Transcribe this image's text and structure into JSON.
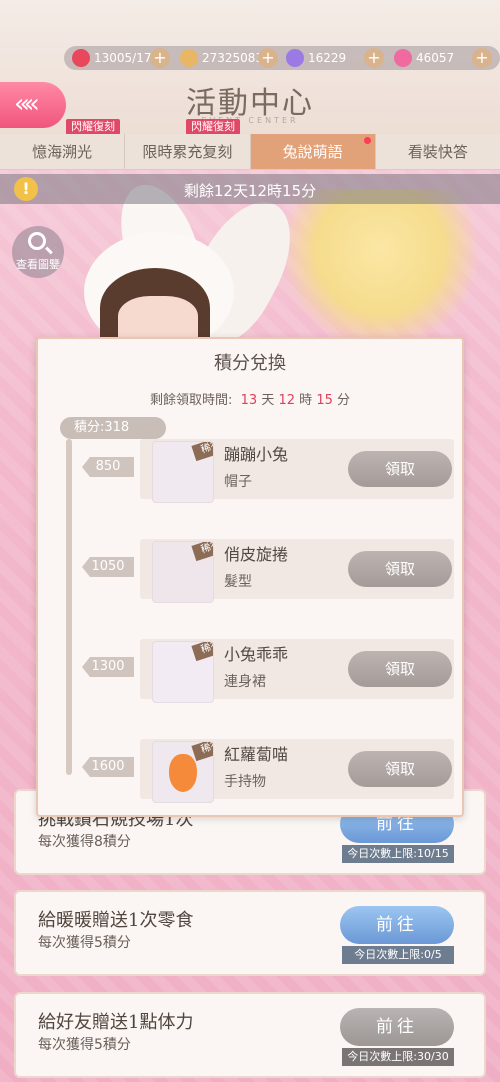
{
  "header": {
    "title": "活動中心",
    "subtitle": "EVENT CENTER",
    "currencies": [
      {
        "icon": "stamina-heart-icon",
        "value": "13005/170"
      },
      {
        "icon": "coin-icon",
        "value": "273250838"
      },
      {
        "icon": "diamond-icon",
        "value": "16229"
      },
      {
        "icon": "pink-gem-icon",
        "value": "46057"
      }
    ],
    "flash_tag_1": "閃耀復刻",
    "flash_tag_2": "閃耀復刻"
  },
  "tabs": [
    {
      "label": "憶海溯光"
    },
    {
      "label": "限時累充复刻"
    },
    {
      "label": "兔說萌語",
      "active": true
    },
    {
      "label": "看裝快答"
    }
  ],
  "event": {
    "countdown": "剩餘12天12時15分",
    "gallery_label": "查看圖鑒"
  },
  "modal": {
    "title": "積分兌換",
    "remain_label": "剩餘領取時間:",
    "days": "13",
    "day_unit": "天",
    "hours": "12",
    "hour_unit": "時",
    "minutes": "15",
    "minute_unit": "分",
    "score": "積分:318",
    "rare_label": "稀有",
    "claim_label": "領取",
    "rewards": [
      {
        "points": "850",
        "name": "蹦蹦小兔",
        "type": "帽子"
      },
      {
        "points": "1050",
        "name": "俏皮旋捲",
        "type": "髮型"
      },
      {
        "points": "1300",
        "name": "小兔乖乖",
        "type": "連身裙"
      },
      {
        "points": "1600",
        "name": "紅蘿蔔喵",
        "type": "手持物"
      }
    ]
  },
  "tasks": [
    {
      "title": "挑戰鑽石競技場1次",
      "reward": "每次獲得8積分",
      "button": "前往",
      "limit": "今日次數上限:10/15",
      "enabled": true
    },
    {
      "title": "給暖暖贈送1次零食",
      "reward": "每次獲得5積分",
      "button": "前往",
      "limit": "今日次數上限:0/5",
      "enabled": true
    },
    {
      "title": "給好友贈送1點体力",
      "reward": "每次獲得5積分",
      "button": "前往",
      "limit": "今日次數上限:30/30",
      "enabled": false
    }
  ],
  "colors": {
    "accent_pink": "#f0557e",
    "active_tab": "#e2a279",
    "countdown_red": "#e0405a",
    "go_blue": "#6b98d7"
  }
}
